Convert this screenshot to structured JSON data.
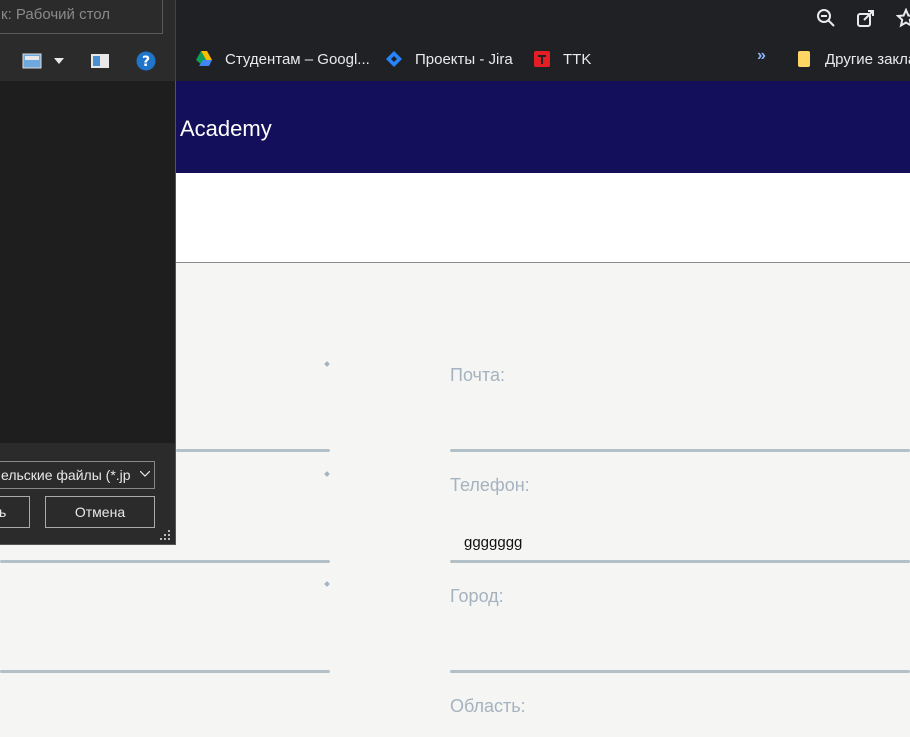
{
  "browser": {
    "bookmarks": [
      {
        "label": "Студентам – Googl...",
        "icon": "google-drive-icon"
      },
      {
        "label": "Проекты - Jira",
        "icon": "jira-icon"
      },
      {
        "label": "TTK",
        "icon": "ttk-icon"
      }
    ],
    "more_label": "»",
    "other_bookmarks": "Другие закла"
  },
  "site": {
    "brand": "Academy"
  },
  "form": {
    "email_label": "Почта:",
    "phone_label": "Телефон:",
    "phone_value": "ggggggg",
    "city_label": "Город:",
    "region_label": "Область:"
  },
  "dialog": {
    "search_placeholder": "к: Рабочий стол",
    "file_type": "ельские файлы (*.jp",
    "open_label": "ь",
    "cancel_label": "Отмена"
  },
  "colors": {
    "header_bg": "#140f5a",
    "accent": "#a4b3bf"
  }
}
